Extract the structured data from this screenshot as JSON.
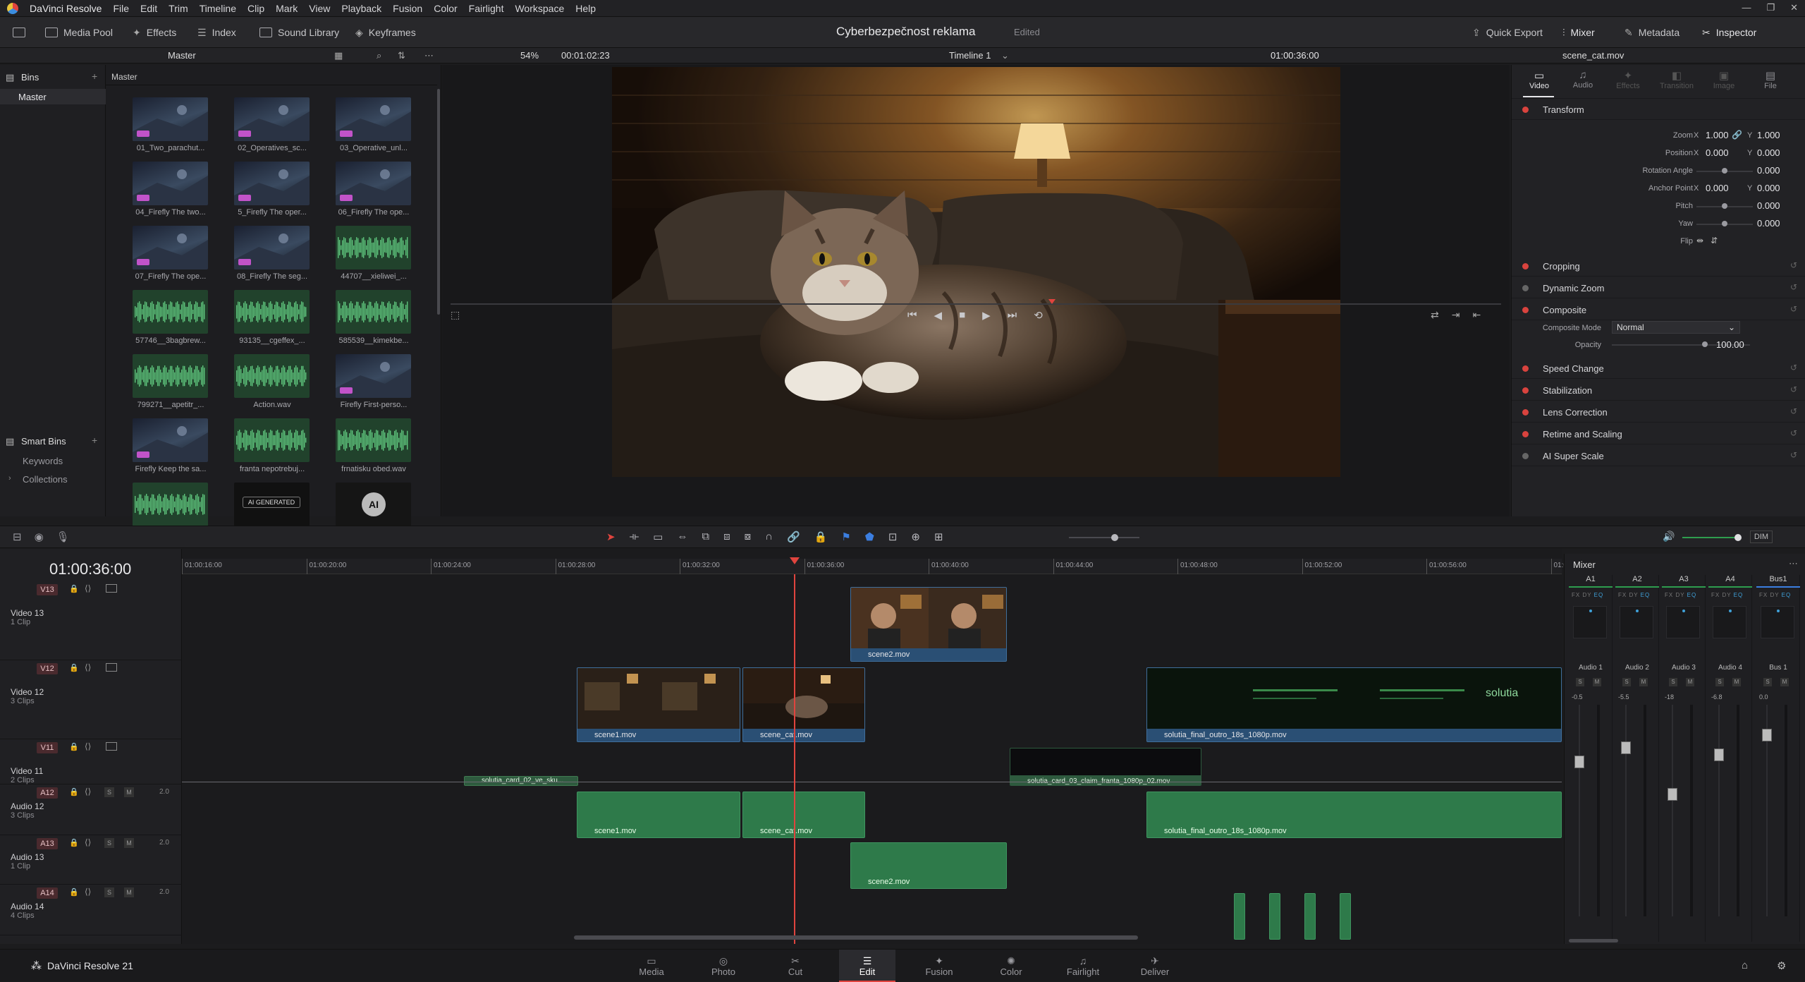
{
  "menubar": {
    "app": "DaVinci Resolve",
    "items": [
      "File",
      "Edit",
      "Trim",
      "Timeline",
      "Clip",
      "Mark",
      "View",
      "Playback",
      "Fusion",
      "Color",
      "Fairlight",
      "Workspace",
      "Help"
    ]
  },
  "toolbar": {
    "media_pool": "Media Pool",
    "effects": "Effects",
    "index": "Index",
    "sound_library": "Sound Library",
    "keyframes": "Keyframes",
    "project_title": "Cyberbezpečnost reklama",
    "project_status": "Edited",
    "quick_export": "Quick Export",
    "mixer": "Mixer",
    "metadata": "Metadata",
    "inspector": "Inspector"
  },
  "subbar": {
    "bin_path": "Master",
    "zoom": "54%",
    "source_tc": "00:01:02:23",
    "timeline_name": "Timeline 1",
    "record_tc": "01:00:36:00",
    "inspector_clip": "scene_cat.mov"
  },
  "bins": {
    "title": "Bins",
    "master": "Master",
    "smart_bins": "Smart Bins",
    "keywords": "Keywords",
    "collections": "Collections"
  },
  "pool": {
    "header": "Master",
    "clips": [
      {
        "label": "01_Two_parachut...",
        "kind": "video",
        "ff": true
      },
      {
        "label": "02_Operatives_sc...",
        "kind": "video",
        "ff": true
      },
      {
        "label": "03_Operative_unl...",
        "kind": "video",
        "ff": true
      },
      {
        "label": "04_Firefly The two...",
        "kind": "video",
        "ff": true
      },
      {
        "label": "5_Firefly The oper...",
        "kind": "video",
        "ff": true
      },
      {
        "label": "06_Firefly The ope...",
        "kind": "video",
        "ff": true
      },
      {
        "label": "07_Firefly The ope...",
        "kind": "video",
        "ff": true
      },
      {
        "label": "08_Firefly The seg...",
        "kind": "video",
        "ff": true
      },
      {
        "label": "44707__xieliwei_...",
        "kind": "audio",
        "ff": false
      },
      {
        "label": "57746__3bagbrew...",
        "kind": "audio",
        "ff": false
      },
      {
        "label": "93135__cgeffex_...",
        "kind": "audio",
        "ff": false
      },
      {
        "label": "585539__kimekbe...",
        "kind": "audio",
        "ff": false
      },
      {
        "label": "799271__apetitr_...",
        "kind": "audio",
        "ff": false
      },
      {
        "label": "Action.wav",
        "kind": "audio",
        "ff": false
      },
      {
        "label": "Firefly First-perso...",
        "kind": "video",
        "ff": true
      },
      {
        "label": "Firefly Keep the sa...",
        "kind": "video",
        "ff": true
      },
      {
        "label": "franta nepotrebuj...",
        "kind": "audio",
        "ff": false
      },
      {
        "label": "frnatisku obed.wav",
        "kind": "audio",
        "ff": false
      },
      {
        "label": "",
        "kind": "audio",
        "ff": false
      },
      {
        "label": "AI GENERATED",
        "kind": "badge",
        "ff": false
      },
      {
        "label": "AI",
        "kind": "ai",
        "ff": false
      }
    ]
  },
  "inspector": {
    "tabs": [
      "Video",
      "Audio",
      "Effects",
      "Transition",
      "Image",
      "File"
    ],
    "transform": "Transform",
    "props": [
      {
        "label": "Zoom",
        "x": "1.000",
        "y": "1.000"
      },
      {
        "label": "Position",
        "x": "0.000",
        "y": "0.000"
      },
      {
        "label": "Rotation Angle",
        "v": "0.000"
      },
      {
        "label": "Anchor Point",
        "x": "0.000",
        "y": "0.000"
      },
      {
        "label": "Pitch",
        "v": "0.000"
      },
      {
        "label": "Yaw",
        "v": "0.000"
      },
      {
        "label": "Flip",
        "v": ""
      }
    ],
    "sections": [
      "Cropping",
      "Dynamic Zoom",
      "Composite",
      "Speed Change",
      "Stabilization",
      "Lens Correction",
      "Retime and Scaling",
      "AI Super Scale"
    ],
    "composite_mode_label": "Composite Mode",
    "composite_mode": "Normal",
    "opacity_label": "Opacity",
    "opacity": "100.00"
  },
  "timeline": {
    "timecode": "01:00:36:00",
    "ruler": [
      "01:00:16:00",
      "01:00:20:00",
      "01:00:24:00",
      "01:00:28:00",
      "01:00:32:00",
      "01:00:36:00",
      "01:00:40:00",
      "01:00:44:00",
      "01:00:48:00",
      "01:00:52:00",
      "01:00:56:00",
      "01:0"
    ],
    "tracks": [
      {
        "tag": "V13",
        "name": "Video 13",
        "count": "1 Clip"
      },
      {
        "tag": "V12",
        "name": "Video 12",
        "count": "3 Clips"
      },
      {
        "tag": "V11",
        "name": "Video 11",
        "count": "2 Clips"
      },
      {
        "tag": "A12",
        "name": "Audio 12",
        "count": "3 Clips",
        "level": "2.0"
      },
      {
        "tag": "A13",
        "name": "Audio 13",
        "count": "1 Clip",
        "level": "2.0"
      },
      {
        "tag": "A14",
        "name": "Audio 14",
        "count": "4 Clips",
        "level": "2.0"
      }
    ],
    "clips": {
      "scene2": "scene2.mov",
      "scene1": "scene1.mov",
      "scene_cat": "scene_cat.mov",
      "outro": "solutia_final_outro_18s_1080p.mov",
      "card2": "solutia_card_02_ve_sku...",
      "card3": "solutia_card_03_claim_franta_1080p_02.mov"
    }
  },
  "mixer": {
    "title": "Mixer",
    "channels": [
      "A1",
      "A2",
      "A3",
      "A4",
      "Bus1"
    ],
    "names": [
      "Audio 1",
      "Audio 2",
      "Audio 3",
      "Audio 4",
      "Bus 1"
    ],
    "levels": [
      "-0.5",
      "-5.5",
      "-18",
      "-6.8",
      "0.0"
    ],
    "dim": "DIM"
  },
  "pages": {
    "items": [
      "Media",
      "Photo",
      "Cut",
      "Edit",
      "Fusion",
      "Color",
      "Fairlight",
      "Deliver"
    ],
    "active": "Edit",
    "brand": "DaVinci Resolve 21"
  }
}
